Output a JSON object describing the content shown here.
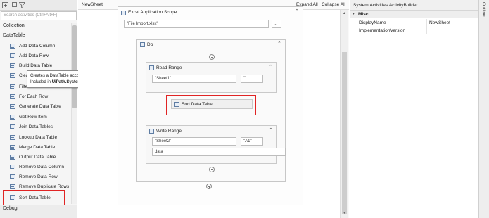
{
  "activities": {
    "search_placeholder": "Search activities (Ctrl+Alt+F)",
    "categories": [
      "Collection",
      "DataTable"
    ],
    "items": [
      "Add Data Column",
      "Add Data Row",
      "Build Data Table",
      "Clear Data Table",
      "Filter Data Table",
      "For Each Row",
      "Generate Data Table",
      "Get Row Item",
      "Join Data Tables",
      "Lookup Data Table",
      "Merge Data Table",
      "Output Data Table",
      "Remove Data Column",
      "Remove Data Row",
      "Remove Duplicate Rows",
      "Sort Data Table"
    ],
    "debug_label": "Debug",
    "tooltip_line1": "Creates a DataTable according to a specified schema.",
    "tooltip_line2_prefix": "Included in ",
    "tooltip_package": "UiPath.System.Activities"
  },
  "designer": {
    "tab_title": "NewSheet",
    "expand_all": "Expand All",
    "collapse_all": "Collapse All",
    "scope_title": "Excel Application Scope",
    "file_path": "\"File Import.xlsx\"",
    "browse_button": "...",
    "do_title": "Do",
    "read_range": {
      "title": "Read Range",
      "sheet": "\"Sheet1\"",
      "range": "\"\""
    },
    "sort_title": "Sort Data Table",
    "write_range": {
      "title": "Write Range",
      "sheet": "\"Sheet2\"",
      "range": "\"A1\"",
      "datatable": "data"
    }
  },
  "properties": {
    "title": "System.Activities.ActivityBuilder",
    "category": "Misc",
    "rows": [
      {
        "name": "DisplayName",
        "value": "NewSheet"
      },
      {
        "name": "ImplementationVersion",
        "value": ""
      }
    ]
  },
  "side_tab": "Outline",
  "colors": {
    "highlight": "#e02424",
    "icon_blue": "#5f7da3",
    "panel_bg": "#f5f5f5"
  }
}
